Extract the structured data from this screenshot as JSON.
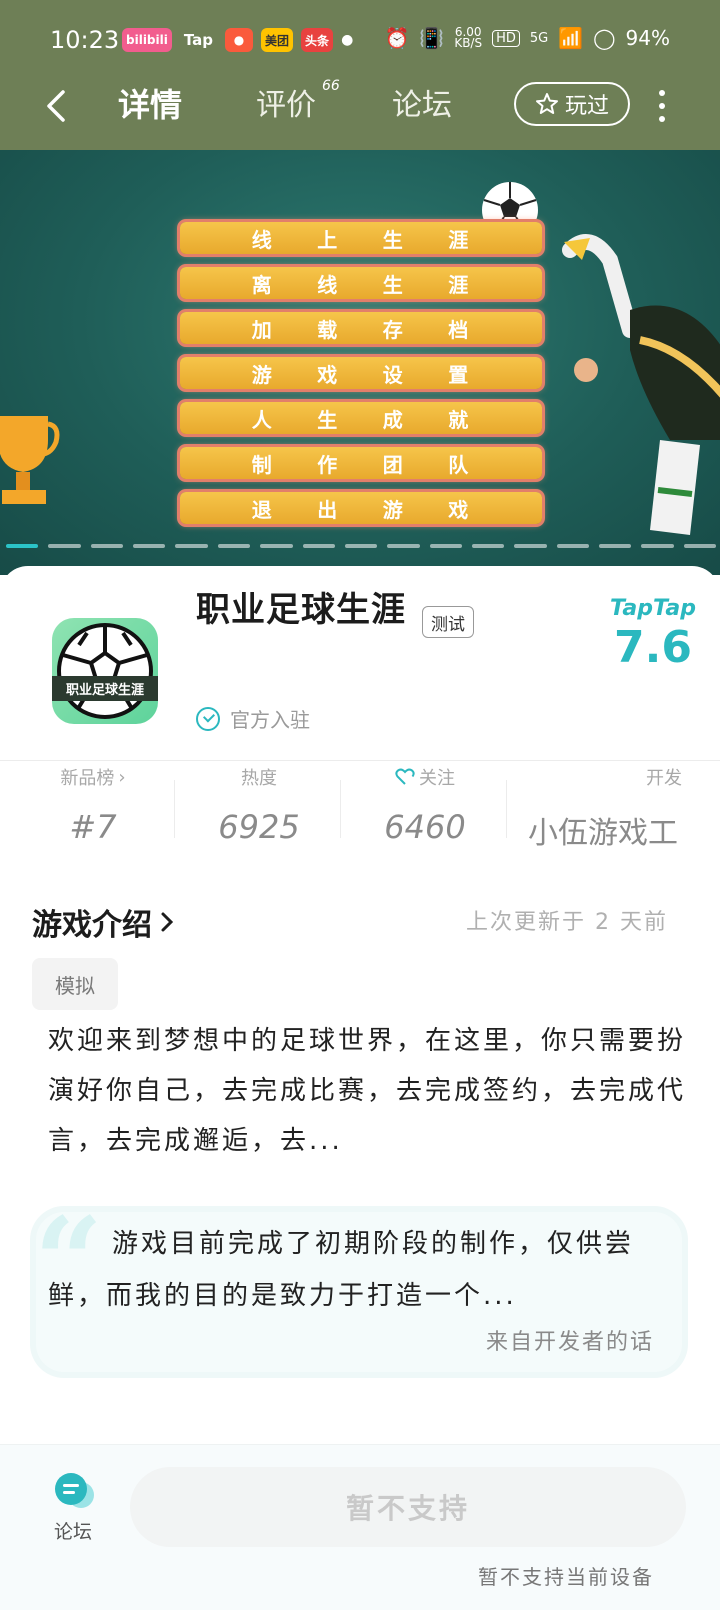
{
  "status_bar": {
    "time": "10:23",
    "app_icons": [
      {
        "label": "bilibili",
        "color": "#f25d8e"
      },
      {
        "label": "Tap",
        "color": "transparent"
      },
      {
        "label": "",
        "color": "#fa5a3c"
      },
      {
        "label": "美团",
        "color": "#ffc300"
      },
      {
        "label": "头条",
        "color": "#e8423f"
      }
    ],
    "net_speed": "6.00",
    "net_unit": "KB/S",
    "hd": "HD",
    "signal": "5G",
    "battery": "94%"
  },
  "nav": {
    "tabs": [
      {
        "label": "详情",
        "active": true
      },
      {
        "label": "评价",
        "active": false
      },
      {
        "label": "论坛",
        "active": false
      }
    ],
    "review_count": "66",
    "played_label": "玩过"
  },
  "banner": {
    "menu_items": [
      "线上生涯",
      "离线生涯",
      "加载存档",
      "游戏设置",
      "人生成就",
      "制作团队",
      "退出游戏"
    ],
    "slide_count": 17,
    "active_slide": 0
  },
  "game": {
    "title": "职业足球生涯",
    "badge": "测试",
    "icon_text": "职业足球生涯",
    "verified_label": "官方入驻",
    "rating_source": "TapTap",
    "rating": "7.6"
  },
  "stats": [
    {
      "label": "新品榜",
      "value": "#7",
      "has_arrow": true
    },
    {
      "label": "热度",
      "value": "6925"
    },
    {
      "label": "关注",
      "value": "6460",
      "has_heart": true
    },
    {
      "label": "开发",
      "value": "小伍游戏工"
    }
  ],
  "intro": {
    "title": "游戏介绍",
    "updated": "上次更新于 2 天前",
    "tag": "模拟",
    "text": "欢迎来到梦想中的足球世界，在这里，你只需要扮演好你自己，去完成比赛，去完成签约，去完成代言，去完成邂逅，去..."
  },
  "developer_note": {
    "text": "游戏目前完成了初期阶段的制作，仅供尝鲜，而我的目的是致力于打造一个...",
    "source": "来自开发者的话"
  },
  "bottom": {
    "forum_label": "论坛",
    "button_label": "暂不支持",
    "note": "暂不支持当前设备"
  },
  "colors": {
    "top_band": "#6e7f56",
    "accent": "#2bb8bf"
  }
}
